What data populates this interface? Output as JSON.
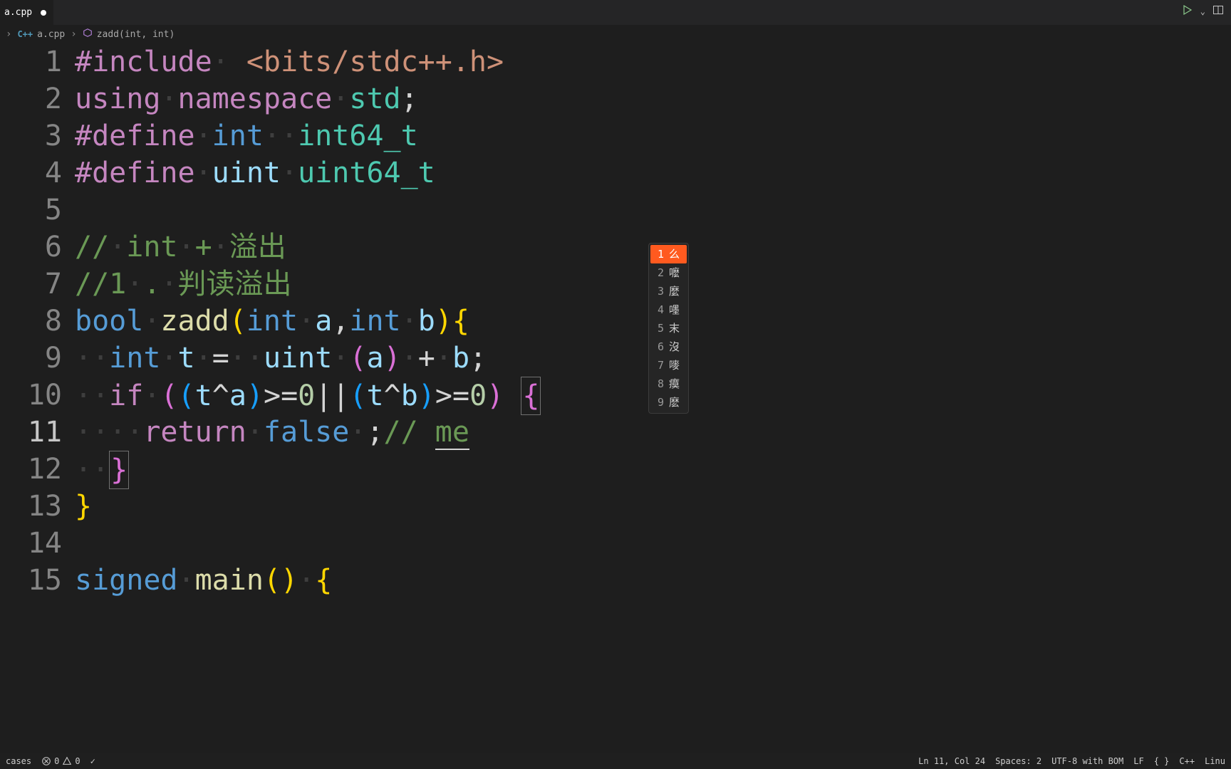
{
  "tab": {
    "filename": "a.cpp",
    "modified": true
  },
  "breadcrumb": {
    "lang_tag": "C++",
    "file": "a.cpp",
    "symbol": "zadd(int, int)"
  },
  "run_controls": {
    "play": "▷",
    "split": "⫿⫿"
  },
  "lines": {
    "count": 15,
    "active": 11,
    "l1": {
      "pre": "#include",
      "rest": " <bits/stdc++.h>"
    },
    "l2": {
      "using": "using",
      "namespace": "namespace",
      "std": "std",
      "semi": ";"
    },
    "l3": {
      "def": "#define",
      "a": "int",
      "b": "int64_t"
    },
    "l4": {
      "def": "#define",
      "a": "uint",
      "b": "uint64_t"
    },
    "l6": "// int + 溢出",
    "l7": "//1 . 判读溢出",
    "l8": {
      "bool": "bool",
      "fn": "zadd",
      "int1": "int",
      "a": "a",
      "int2": "int",
      "b": "b"
    },
    "l9": {
      "int": "int",
      "t": "t",
      "eq": "=",
      "uint": "uint",
      "a": "a",
      "plus": "+",
      "b": "b"
    },
    "l10": {
      "if": "if",
      "t1": "t",
      "a": "a",
      "ge1": ">=",
      "z1": "0",
      "or": "||",
      "t2": "t",
      "b": "b",
      "ge2": ">=",
      "z2": "0)"
    },
    "l11": {
      "return": "return",
      "false": "false",
      "semi": ";",
      "cmt": "// ",
      "ime": "me"
    },
    "l12": {
      "brace": "}"
    },
    "l13": {
      "brace": "}"
    },
    "l15": {
      "signed": "signed",
      "main": "main",
      "paren": "()",
      "brace": "{"
    }
  },
  "ime": {
    "items": [
      {
        "idx": "1",
        "text": "么"
      },
      {
        "idx": "2",
        "text": "嚒"
      },
      {
        "idx": "3",
        "text": "麼"
      },
      {
        "idx": "4",
        "text": "嚜"
      },
      {
        "idx": "5",
        "text": "末"
      },
      {
        "idx": "6",
        "text": "沒"
      },
      {
        "idx": "7",
        "text": "嘜"
      },
      {
        "idx": "8",
        "text": "瘼"
      },
      {
        "idx": "9",
        "text": "麽"
      }
    ]
  },
  "statusbar": {
    "left": {
      "cases": "cases",
      "errors": "0",
      "warnings": "0",
      "check": "✓"
    },
    "right": {
      "pos": "Ln 11, Col 24",
      "spaces": "Spaces: 2",
      "encoding": "UTF-8 with BOM",
      "eol": "LF",
      "braces": "{ }",
      "lang": "C++",
      "os": "Linu"
    }
  }
}
